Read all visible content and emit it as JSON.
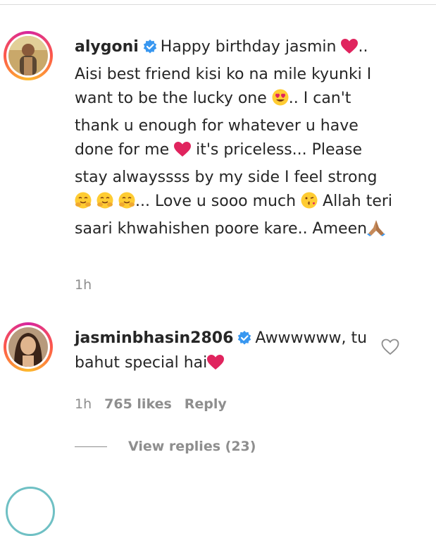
{
  "comments": [
    {
      "username": "alygoni",
      "text_parts": [
        "Happy birthday jasmin ",
        ".. Aisi best friend kisi ko na mile kyunki I want to be the lucky one ",
        ".. I can't thank u enough for whatever u have done for me ",
        " it's priceless... Please stay alwayssss by my side I feel strong ",
        "... Love u sooo much ",
        " Allah teri saari khwahishen poore kare.. Ameen"
      ],
      "time": "1h",
      "verified": true
    },
    {
      "username": "jasminbhasin2806",
      "text_parts": [
        "Awwwwww, tu bahut special hai"
      ],
      "time": "1h",
      "likes": "765 likes",
      "reply_label": "Reply",
      "verified": true,
      "view_replies_label": "View replies (23)"
    }
  ],
  "icons": {
    "verified": "verified-badge-icon",
    "red_heart": "red-heart-emoji",
    "heart_eyes": "heart-eyes-emoji",
    "hug": "hugging-emoji",
    "kiss": "kiss-emoji",
    "pray": "folded-hands-emoji",
    "like": "heart-outline-icon"
  },
  "colors": {
    "verified_blue": "#3897f0",
    "meta_gray": "#8e8e8e",
    "text": "#262626",
    "heart_red": "#e0245e"
  }
}
